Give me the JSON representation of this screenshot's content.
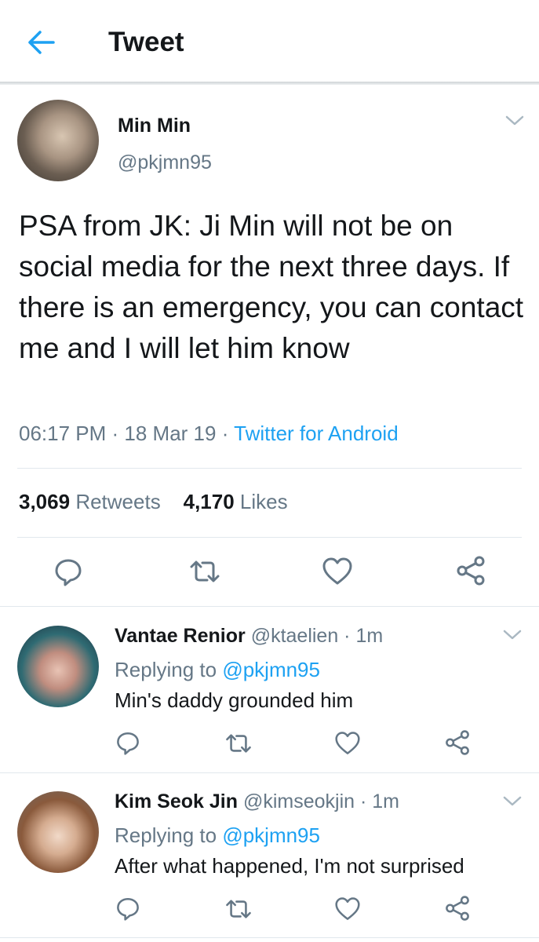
{
  "header": {
    "title": "Tweet"
  },
  "tweet": {
    "author_name": "Min Min",
    "author_handle": "@pkjmn95",
    "text": "PSA from JK: Ji Min will not be on social media for the next three days. If there is an emergency, you can contact me and I will let him know",
    "time": "06:17 PM",
    "sep1": " · ",
    "date": "18 Mar 19",
    "sep2": " · ",
    "source": "Twitter for Android",
    "retweets_count": "3,069",
    "retweets_label": "Retweets",
    "likes_count": "4,170",
    "likes_label": "Likes"
  },
  "replies": [
    {
      "name": "Vantae Renior",
      "handle_time": "@ktaelien · 1m",
      "replying_label": "Replying to",
      "replying_to": "@pkjmn95",
      "text": "Min's daddy grounded him"
    },
    {
      "name": "Kim Seok Jin",
      "handle_time": "@kimseokjin · 1m",
      "replying_label": "Replying to",
      "replying_to": "@pkjmn95",
      "text": "After what happened, I'm not surprised"
    }
  ],
  "icons": {
    "back": "arrow-left-icon",
    "reply": "speech-bubble-icon",
    "retweet": "retweet-arrows-icon",
    "like": "heart-icon",
    "share": "share-nodes-icon",
    "menu": "chevron-down-icon"
  },
  "colors": {
    "accent": "#1da1f2",
    "secondary_text": "#657786",
    "primary_text": "#14171a",
    "divider": "#e1e8ed"
  }
}
